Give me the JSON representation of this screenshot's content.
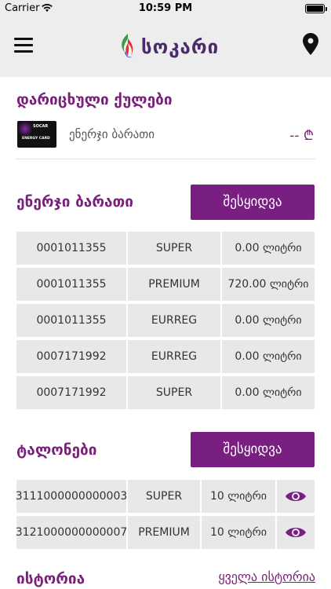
{
  "status_bar": {
    "carrier": "Carrier",
    "time": "10:59 PM"
  },
  "header": {
    "logo_text": "სოკარი",
    "menu_icon": "hamburger-menu-icon",
    "location_icon": "map-pin-icon"
  },
  "selected_cards": {
    "title": "დარიცხული ქულები",
    "card": {
      "brand": "SOCAR",
      "card_label": "ENERGY CARD",
      "name": "ენერჯი ბარათი",
      "balance": "-- ₾"
    }
  },
  "energy_card": {
    "title": "ენერჯი ბარათი",
    "button_label": "შესყიდვა",
    "rows": [
      {
        "number": "0001011355",
        "fuel": "SUPER",
        "amount": "0.00 ლიტრი"
      },
      {
        "number": "0001011355",
        "fuel": "PREMIUM",
        "amount": "720.00 ლიტრი"
      },
      {
        "number": "0001011355",
        "fuel": "EURREG",
        "amount": "0.00 ლიტრი"
      },
      {
        "number": "0007171992",
        "fuel": "EURREG",
        "amount": "0.00 ლიტრი"
      },
      {
        "number": "0007171992",
        "fuel": "SUPER",
        "amount": "0.00 ლიტრი"
      }
    ]
  },
  "coupons": {
    "title": "ტალონები",
    "button_label": "შესყიდვა",
    "rows": [
      {
        "number": "3111000000000003",
        "fuel": "SUPER",
        "amount": "10 ლიტრი",
        "icon": "eye-icon"
      },
      {
        "number": "3121000000000007",
        "fuel": "PREMIUM",
        "amount": "10 ლიტრი",
        "icon": "eye-icon"
      }
    ]
  },
  "history": {
    "title": "ისტორია",
    "all_link": "ყველა ისტორია"
  },
  "colors": {
    "accent": "#7a1f82",
    "header_bg": "#ededed",
    "cell_bg": "#e8e8ea"
  }
}
